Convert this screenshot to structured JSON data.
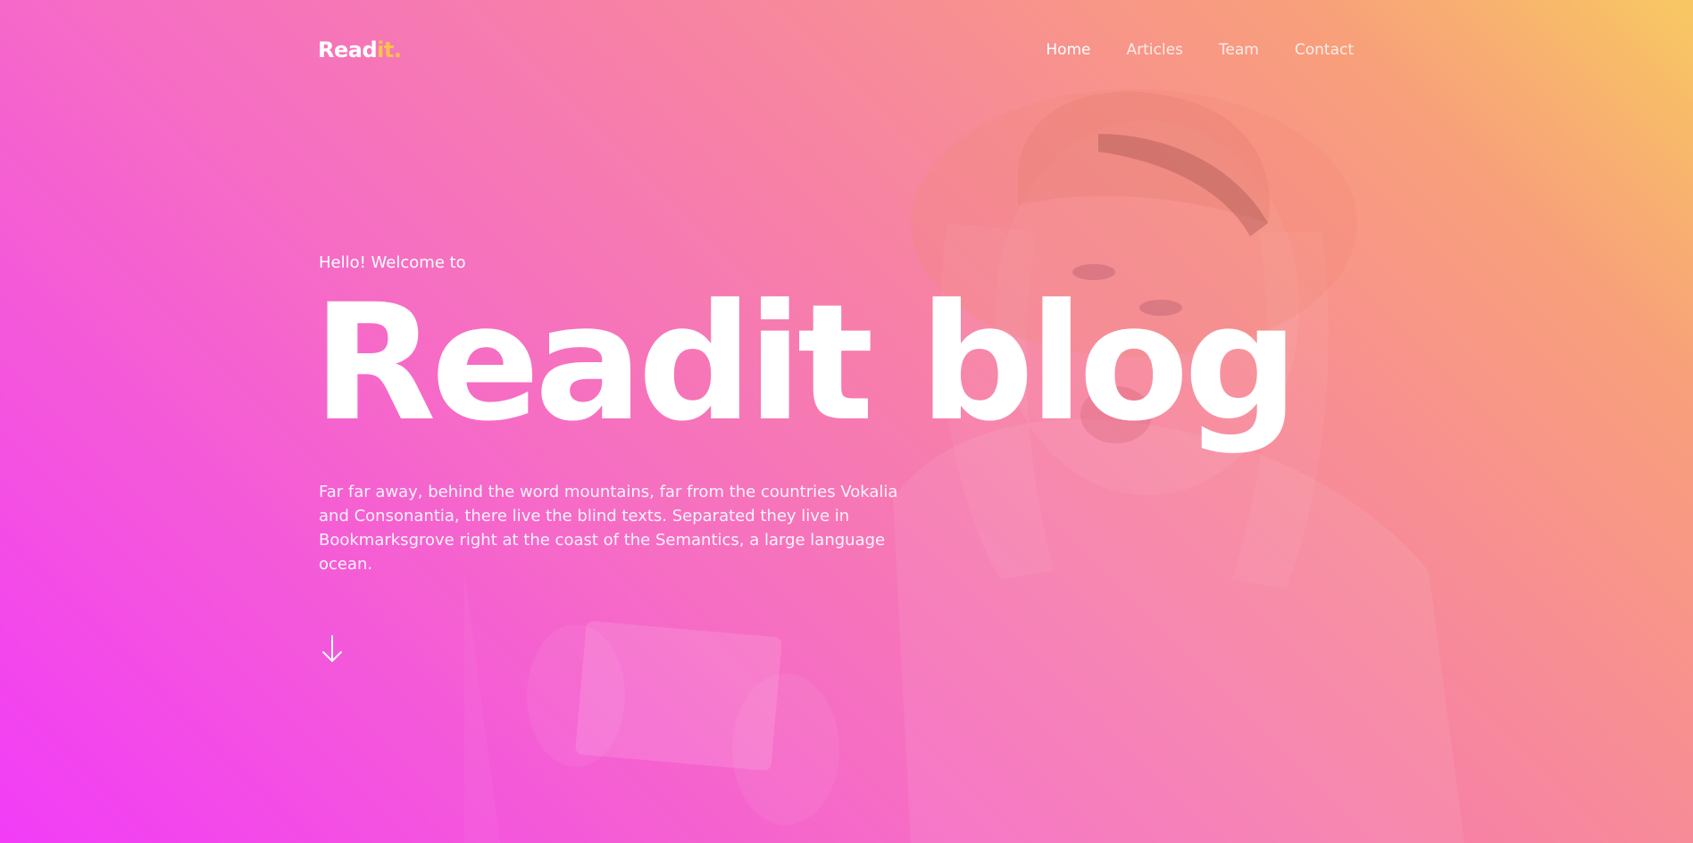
{
  "header": {
    "logo": {
      "main": "Read",
      "accent": "it",
      "dot": "."
    },
    "nav": [
      {
        "label": "Home",
        "active": true
      },
      {
        "label": "Articles",
        "active": false
      },
      {
        "label": "Team",
        "active": false
      },
      {
        "label": "Contact",
        "active": false
      }
    ]
  },
  "hero": {
    "subtitle": "Hello! Welcome to",
    "title": "Readit blog",
    "description": "Far far away, behind the word mountains, far from the countries Vokalia and Consonantia, there live the blind texts. Separated they live in Bookmarksgrove right at the coast of the Semantics, a large language ocean.",
    "scroll_icon": "arrow-down-icon"
  },
  "colors": {
    "gradient_start": "#f23cf7",
    "gradient_end": "#f8c862",
    "logo_accent": "#f9c24d",
    "text": "#ffffff"
  }
}
